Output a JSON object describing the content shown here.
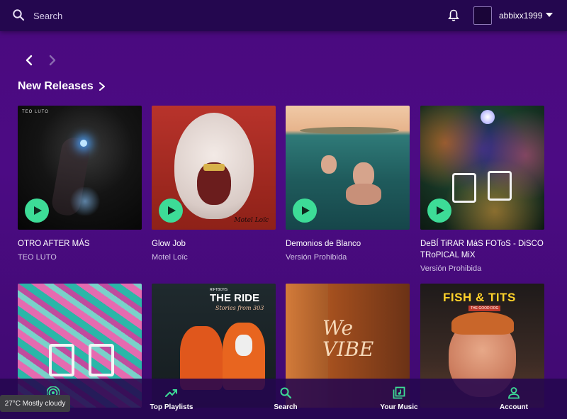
{
  "header": {
    "search_placeholder": "Search",
    "username": "abbixx1999"
  },
  "section": {
    "title": "New Releases"
  },
  "releases": [
    {
      "title": "OTRO AFTER MÁS",
      "artist": "TEO LUTO",
      "cover_text": "TEO LUTO"
    },
    {
      "title": "Glow Job",
      "artist": "Motel Loïc",
      "cover_text": "Motel Loïc"
    },
    {
      "title": "Demonios de Blanco",
      "artist": "Versión Prohibida"
    },
    {
      "title": "DeBÍ TiRAR MáS FOToS - DiSCO TRoPICAL MiX",
      "artist": "Versión Prohibida"
    }
  ],
  "second_row": [
    {
      "cover_text": ""
    },
    {
      "cover_text_top": "RIFTBOYS",
      "cover_text": "THE RIDE",
      "cover_sub": "Stories from 303"
    },
    {
      "cover_text": "We VIBE"
    },
    {
      "cover_text": "FISH & TITS",
      "cover_sub": "THE GOOD DOG"
    }
  ],
  "bottom_nav": [
    {
      "label": "",
      "icon": "broadcast-icon"
    },
    {
      "label": "Top Playlists",
      "icon": "trending-icon"
    },
    {
      "label": "Search",
      "icon": "search-icon"
    },
    {
      "label": "Your Music",
      "icon": "library-icon"
    },
    {
      "label": "Account",
      "icon": "account-icon"
    }
  ],
  "weather": {
    "text": "27°C Mostly cloudy"
  },
  "colors": {
    "accent": "#3ddc97",
    "topbar": "#24074f",
    "background": "#4c0b84"
  }
}
